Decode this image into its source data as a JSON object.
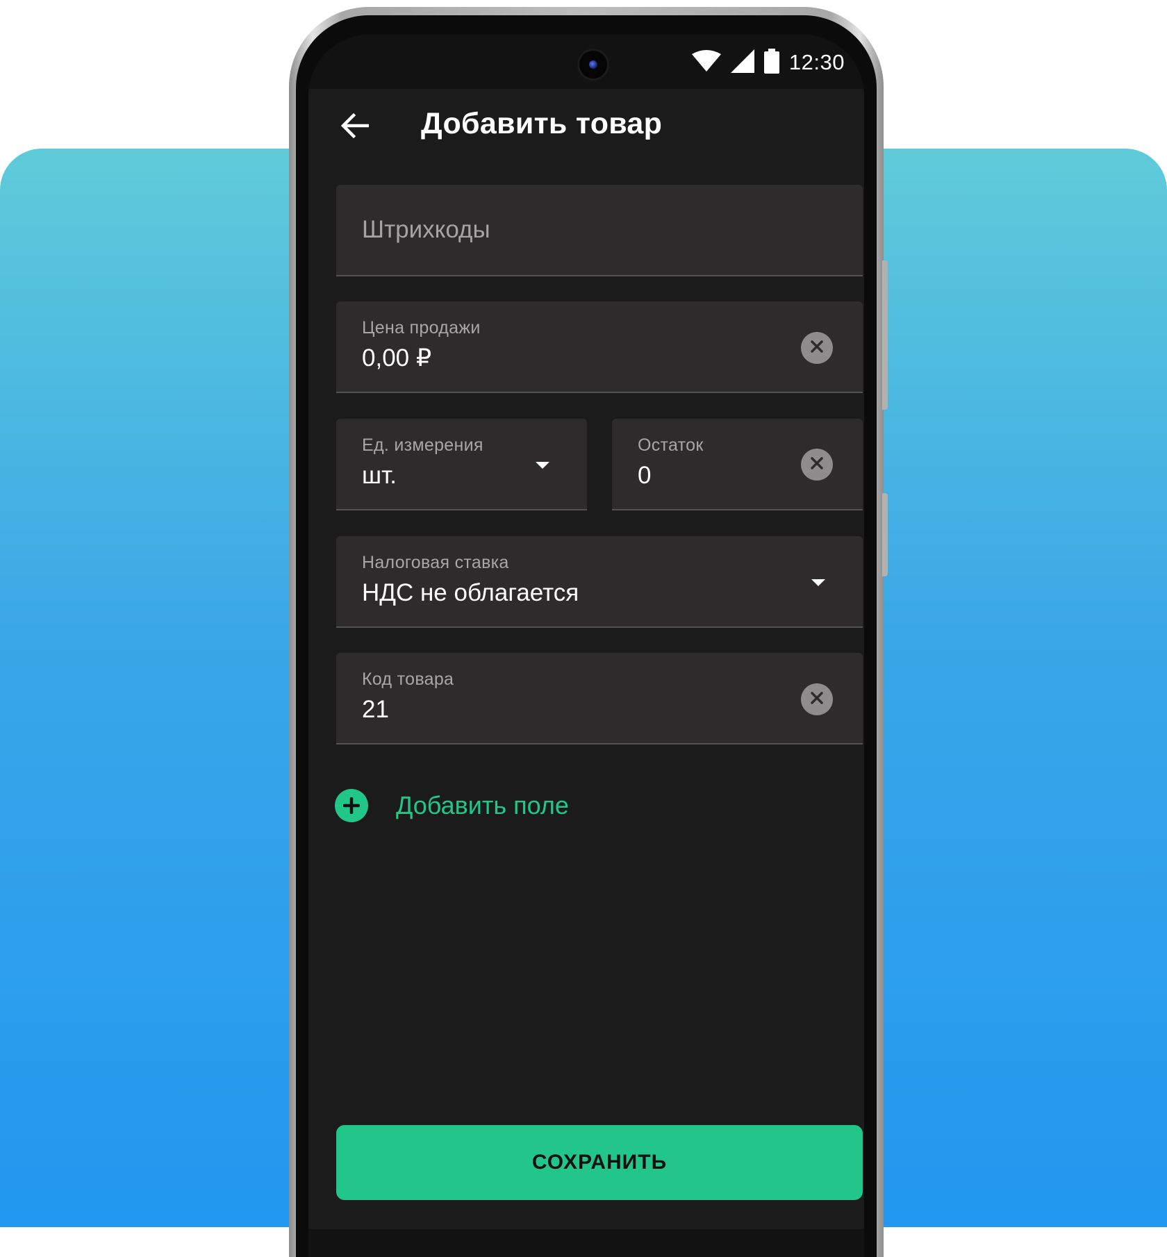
{
  "status_bar": {
    "time": "12:30",
    "icons": [
      "wifi-icon",
      "signal-icon",
      "battery-icon"
    ]
  },
  "app_bar": {
    "back_icon": "arrow-left-icon",
    "title": "Добавить товар"
  },
  "form": {
    "barcodes": {
      "placeholder": "Штрихкоды"
    },
    "sale_price": {
      "label": "Цена продажи",
      "value": "0,00 ₽"
    },
    "unit": {
      "label": "Ед. измерения",
      "value": "шт."
    },
    "stock": {
      "label": "Остаток",
      "value": "0"
    },
    "tax_rate": {
      "label": "Налоговая ставка",
      "value": "НДС не облагается"
    },
    "product_code": {
      "label": "Код товара",
      "value": "21"
    }
  },
  "add_field": {
    "label": "Добавить поле"
  },
  "save_button": {
    "label": "СОХРАНИТЬ"
  },
  "colors": {
    "accent": "#20c789",
    "screen_bg": "#1c1b1c",
    "field_bg": "#2e2b2c",
    "page_gradient_top": "#5fcbd9",
    "page_gradient_bottom": "#2197ef"
  }
}
